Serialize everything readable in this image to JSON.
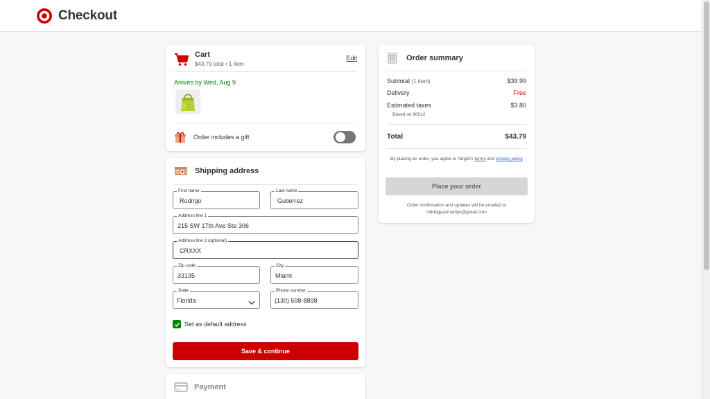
{
  "header": {
    "title": "Checkout",
    "brand_color": "#cc0000"
  },
  "cart": {
    "title": "Cart",
    "subtitle": "$43.79 total • 1 item",
    "edit_label": "Edit",
    "arrival": "Arrives by Wed, Aug 9",
    "item_image_icon": "green-tote-bag",
    "gift_label": "Order includes a gift",
    "gift_toggle_on": false
  },
  "shipping": {
    "title": "Shipping address",
    "fields": {
      "first_name": {
        "label": "First name",
        "value": "Rodrigo"
      },
      "last_name": {
        "label": "Last name",
        "value": "Gutierrez"
      },
      "address1": {
        "label": "Address line 1",
        "value": "215 SW 17th Ave Ste 306"
      },
      "address2": {
        "label": "Address line 2 (optional)",
        "value": "CRXXX"
      },
      "zip": {
        "label": "Zip code",
        "value": "33135"
      },
      "city": {
        "label": "City",
        "value": "Miami"
      },
      "state": {
        "label": "State",
        "value": "Florida"
      },
      "phone": {
        "label": "Phone number",
        "value": "(130) 598-8898"
      }
    },
    "default_label": "Set as default address",
    "default_checked": true,
    "save_label": "Save & continue"
  },
  "payment": {
    "title": "Payment"
  },
  "summary": {
    "title": "Order summary",
    "subtotal_label": "Subtotal",
    "subtotal_count": "(1 item)",
    "subtotal_value": "$39.99",
    "delivery_label": "Delivery",
    "delivery_value": "Free",
    "taxes_label": "Estimated taxes",
    "taxes_value": "$3.80",
    "based_on": "Based on 90012",
    "total_label": "Total",
    "total_value": "$43.79",
    "terms_prefix": "By placing an order, you agree to Target's",
    "terms_link": "terms",
    "terms_and": "and",
    "privacy_link": "privacy policy",
    "place_label": "Place your order",
    "confirm_text": "Order confirmation and updates will be emailed to",
    "email": "miblogpazmarilyn@gmail.com"
  },
  "colors": {
    "accent_red": "#cc0000",
    "success_green": "#008300",
    "disabled_gray": "#d6d6d6"
  }
}
